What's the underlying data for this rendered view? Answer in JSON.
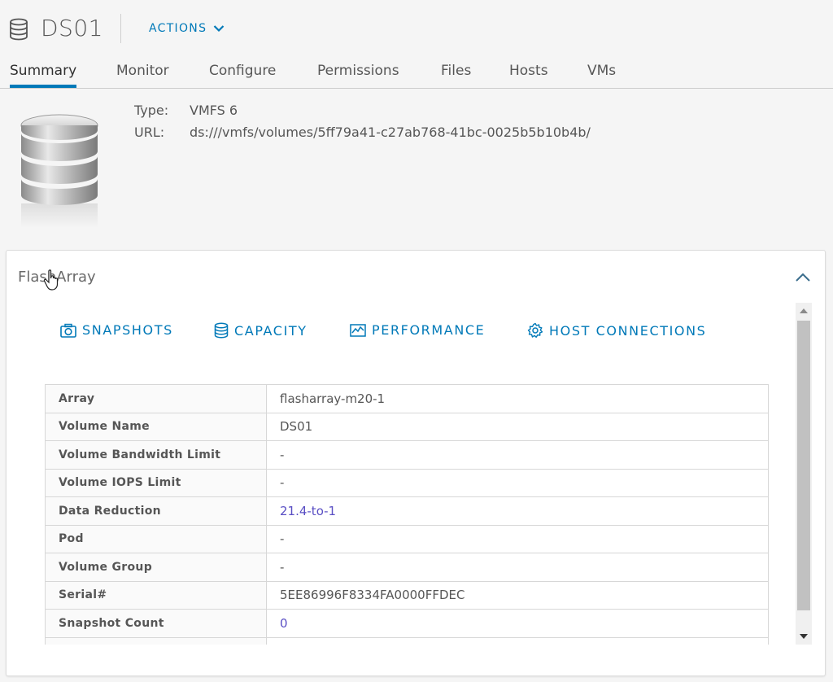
{
  "header": {
    "title": "DS01",
    "actions_label": "ACTIONS"
  },
  "tabs": [
    {
      "label": "Summary",
      "active": true
    },
    {
      "label": "Monitor"
    },
    {
      "label": "Configure"
    },
    {
      "label": "Permissions"
    },
    {
      "label": "Files"
    },
    {
      "label": "Hosts"
    },
    {
      "label": "VMs"
    }
  ],
  "summary": {
    "type_label": "Type:",
    "type_value": "VMFS 6",
    "url_label": "URL:",
    "url_value": "ds:///vmfs/volumes/5ff79a41-c27ab768-41bc-0025b5b10b4b/"
  },
  "flasharray": {
    "title": "FlashArray",
    "buttons": {
      "snapshots": "SNAPSHOTS",
      "capacity": "CAPACITY",
      "performance": "PERFORMANCE",
      "host_connections": "HOST CONNECTIONS"
    },
    "rows": [
      {
        "key": "Array",
        "value": "flasharray-m20-1"
      },
      {
        "key": "Volume Name",
        "value": "DS01"
      },
      {
        "key": "Volume Bandwidth Limit",
        "value": "-"
      },
      {
        "key": "Volume IOPS Limit",
        "value": "-"
      },
      {
        "key": "Data Reduction",
        "value": "21.4-to-1"
      },
      {
        "key": "Pod",
        "value": "-"
      },
      {
        "key": "Volume Group",
        "value": "-"
      },
      {
        "key": "Serial#",
        "value": "5EE86996F8334FA0000FFDEC"
      },
      {
        "key": "Snapshot Count",
        "value": "0"
      },
      {
        "key": "",
        "value": ""
      }
    ]
  },
  "colors": {
    "accent": "#0079b8",
    "link_value": "#5a4fc4"
  },
  "icons": {
    "datastore": "datastore-icon",
    "chevron": "chevron-down-icon",
    "collapse": "chevron-up-icon",
    "camera": "camera-icon",
    "capacity": "database-icon",
    "performance": "line-chart-icon",
    "host": "gear-icon"
  }
}
